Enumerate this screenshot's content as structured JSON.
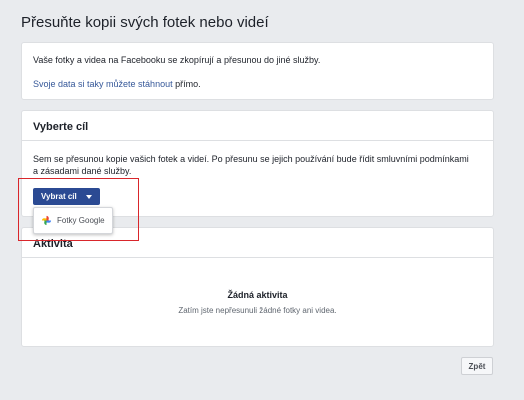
{
  "page": {
    "title": "Přesuňte kopii svých fotek nebo videí"
  },
  "info": {
    "text": "Vaše fotky a videa na Facebooku se zkopírují a přesunou do jiné služby.",
    "link_text": "Svoje data si taky můžete stáhnout",
    "link_suffix": " přímo."
  },
  "destination": {
    "title": "Vyberte cíl",
    "description": "Sem se přesunou kopie vašich fotek a videí. Po přesunu se jejich používání bude řídit smluvními podmínkami a zásadami dané služby.",
    "select_button_label": "Vybrat cíl",
    "dropdown_options": [
      {
        "label": "Fotky Google",
        "icon": "google-photos-icon"
      }
    ]
  },
  "activity": {
    "title": "Aktivita",
    "empty_title": "Žádná aktivita",
    "empty_subtitle": "Zatím jste nepřesunuli žádné fotky ani videa."
  },
  "footer": {
    "back_label": "Zpět"
  },
  "colors": {
    "background": "#e9ebee",
    "primary_button": "#2b4a93",
    "link": "#365899",
    "highlight": "#d9262b"
  }
}
